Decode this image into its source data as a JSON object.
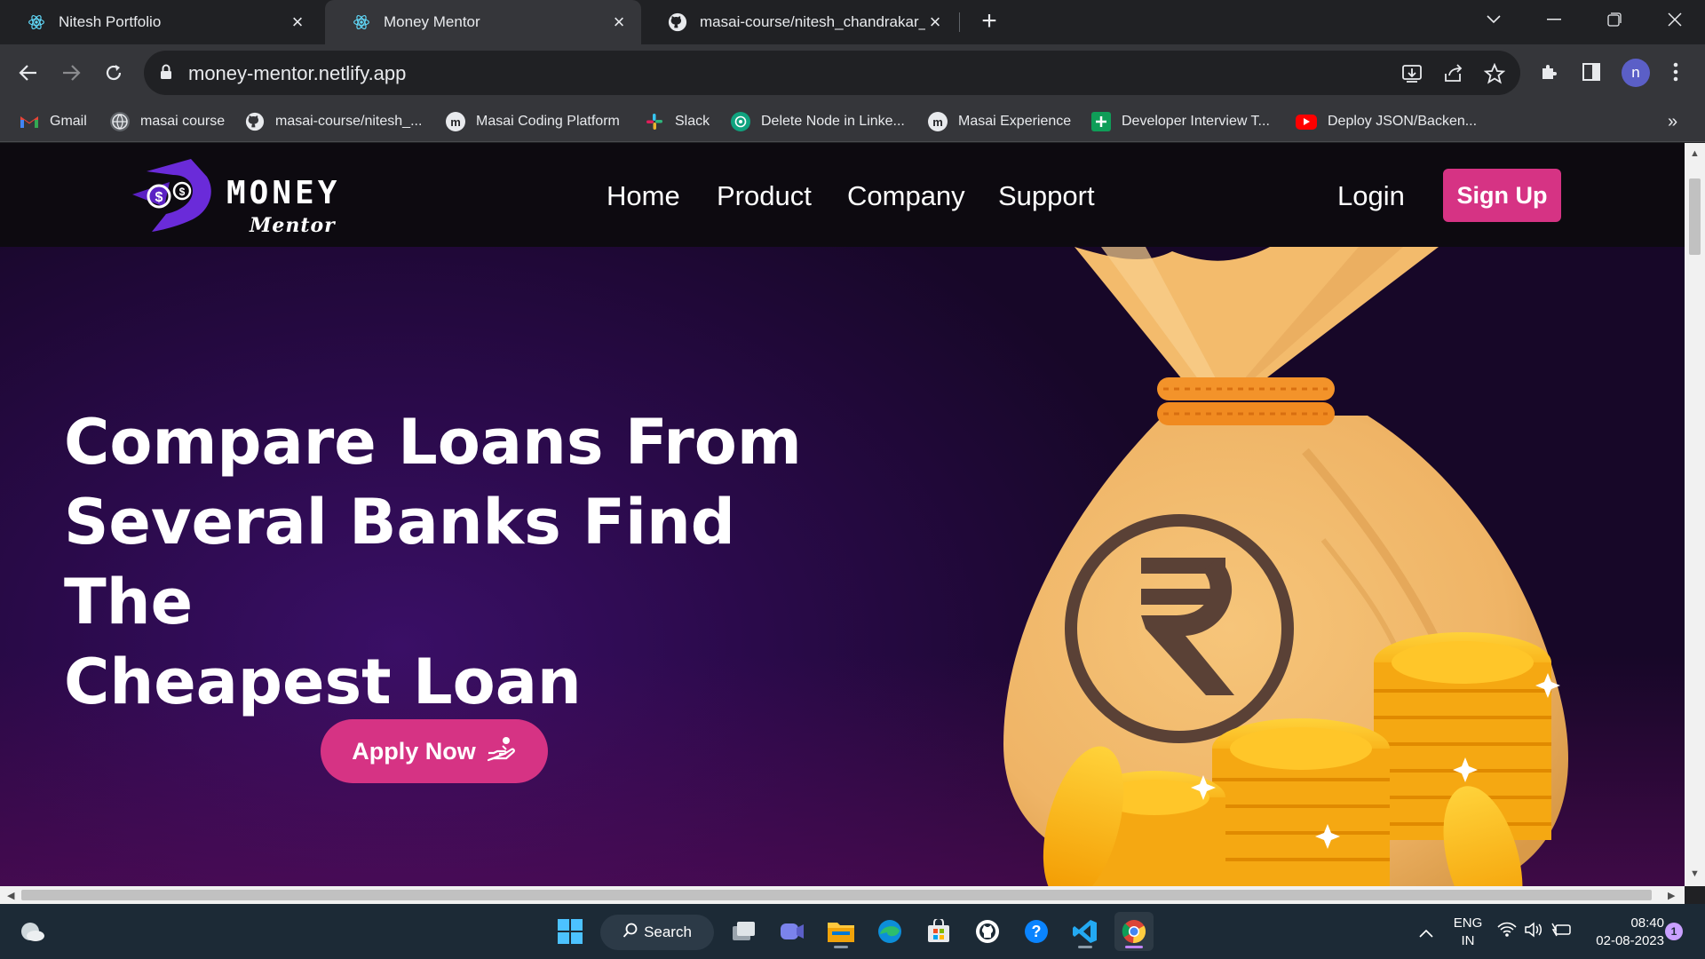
{
  "browser": {
    "tabs": [
      {
        "title": "Nitesh Portfolio",
        "icon": "react-icon",
        "active": false
      },
      {
        "title": "Money Mentor",
        "icon": "react-icon",
        "active": true
      },
      {
        "title": "masai-course/nitesh_chandrakar_fw",
        "icon": "github-icon",
        "active": false
      }
    ],
    "new_tab_label": "+",
    "url": "money-mentor.netlify.app",
    "profile_initial": "n",
    "bookmarks": [
      {
        "label": "Gmail",
        "icon": "gmail-icon"
      },
      {
        "label": "masai course",
        "icon": "globe-icon"
      },
      {
        "label": "masai-course/nitesh_...",
        "icon": "github-icon"
      },
      {
        "label": "Masai Coding Platform",
        "icon": "masai-icon"
      },
      {
        "label": "Slack",
        "icon": "slack-icon"
      },
      {
        "label": "Delete Node in Linke...",
        "icon": "chatgpt-icon"
      },
      {
        "label": "Masai Experience",
        "icon": "masai-icon"
      },
      {
        "label": "Developer Interview T...",
        "icon": "sheets-icon"
      },
      {
        "label": "Deploy JSON/Backen...",
        "icon": "youtube-icon"
      }
    ],
    "bookmarks_overflow": "»"
  },
  "site": {
    "logo": {
      "line1": "MONEY",
      "line2": "Mentor"
    },
    "nav": [
      "Home",
      "Product",
      "Company",
      "Support"
    ],
    "login": "Login",
    "signup": "Sign Up",
    "hero": {
      "headline_lines": [
        "Compare Loans From",
        "Several Banks Find The",
        "Cheapest Loan"
      ],
      "cta": "Apply Now"
    },
    "colors": {
      "accent": "#d63384",
      "hero_bg": "#2a0a4a",
      "nav_bg": "#0d0a10"
    }
  },
  "taskbar": {
    "search_label": "Search",
    "language": "ENG",
    "region": "IN",
    "time": "08:40",
    "date": "02-08-2023",
    "notification_count": "1"
  }
}
